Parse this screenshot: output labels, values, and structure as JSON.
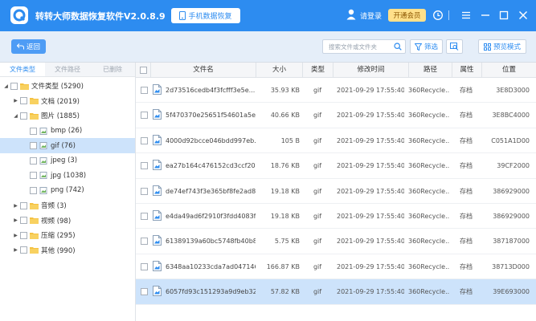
{
  "colors": {
    "accent": "#2d8cf0",
    "vip": "#ffe08a",
    "selected_row": "#cde3fb",
    "toolbar_bg": "#e5eef9"
  },
  "titlebar": {
    "title": "转转大师数据恢复软件V2.0.8.9",
    "phone_btn": "手机数据恢复",
    "login": "请登录",
    "vip": "开通会员",
    "icons": [
      "phone-icon",
      "user-icon",
      "refresh-icon",
      "menu-icon",
      "minimize-icon",
      "maximize-icon",
      "close-icon"
    ]
  },
  "toolbar": {
    "back": "返回",
    "search_placeholder": "搜索文件或文件夹",
    "filter": "筛选",
    "preview_mode": "预览模式"
  },
  "sidebar": {
    "tabs": [
      "文件类型",
      "文件路径",
      "已删除"
    ],
    "tree": [
      {
        "label": "文件类型 (5290)",
        "level": 0,
        "expanded": true
      },
      {
        "label": "文档 (2019)",
        "level": 1,
        "expanded": false
      },
      {
        "label": "图片 (1885)",
        "level": 1,
        "expanded": true
      },
      {
        "label": "bmp (26)",
        "level": 2
      },
      {
        "label": "gif (76)",
        "level": 2,
        "selected": true
      },
      {
        "label": "jpeg (3)",
        "level": 2
      },
      {
        "label": "jpg (1038)",
        "level": 2
      },
      {
        "label": "png (742)",
        "level": 2
      },
      {
        "label": "音频 (3)",
        "level": 1,
        "expanded": false
      },
      {
        "label": "视频 (98)",
        "level": 1,
        "expanded": false
      },
      {
        "label": "压缩 (295)",
        "level": 1,
        "expanded": false
      },
      {
        "label": "其他 (990)",
        "level": 1,
        "expanded": false
      }
    ]
  },
  "table": {
    "headers": {
      "name": "文件名",
      "size": "大小",
      "type": "类型",
      "time": "修改时间",
      "path": "路径",
      "attr": "属性",
      "pos": "位置"
    },
    "rows": [
      {
        "name": "2d73516cedb4f3fcfff3e5e...",
        "size": "35.93 KB",
        "type": "gif",
        "time": "2021-09-29 17:55:40",
        "path": "360Recycle...",
        "attr": "存档",
        "pos": "3E8D3000"
      },
      {
        "name": "5f470370e25651f54601a5e...",
        "size": "40.66 KB",
        "type": "gif",
        "time": "2021-09-29 17:55:40",
        "path": "360Recycle...",
        "attr": "存档",
        "pos": "3E8BC4000"
      },
      {
        "name": "4000d92bcce046bdd997eb...",
        "size": "105 B",
        "type": "gif",
        "time": "2021-09-29 17:55:40",
        "path": "360Recycle...",
        "attr": "存档",
        "pos": "C051A1D00"
      },
      {
        "name": "ea27b164c476152cd3ccf20...",
        "size": "18.76 KB",
        "type": "gif",
        "time": "2021-09-29 17:55:40",
        "path": "360Recycle...",
        "attr": "存档",
        "pos": "39CF2000"
      },
      {
        "name": "de74ef743f3e365bf8fe2ad8...",
        "size": "19.18 KB",
        "type": "gif",
        "time": "2021-09-29 17:55:40",
        "path": "360Recycle...",
        "attr": "存档",
        "pos": "386929000"
      },
      {
        "name": "e4da49ad6f2910f3fdd4083f...",
        "size": "19.18 KB",
        "type": "gif",
        "time": "2021-09-29 17:55:40",
        "path": "360Recycle...",
        "attr": "存档",
        "pos": "386929000"
      },
      {
        "name": "61389139a60bc5748fb40b8...",
        "size": "5.75 KB",
        "type": "gif",
        "time": "2021-09-29 17:55:40",
        "path": "360Recycle...",
        "attr": "存档",
        "pos": "387187000"
      },
      {
        "name": "6348aa10233cda7ad047146...",
        "size": "166.87 KB",
        "type": "gif",
        "time": "2021-09-29 17:55:40",
        "path": "360Recycle...",
        "attr": "存档",
        "pos": "38713D000"
      },
      {
        "name": "6057fd93c151293a9d9eb32...",
        "size": "57.82 KB",
        "type": "gif",
        "time": "2021-09-29 17:55:40",
        "path": "360Recycle...",
        "attr": "存档",
        "pos": "39E693000",
        "selected": true
      }
    ]
  }
}
